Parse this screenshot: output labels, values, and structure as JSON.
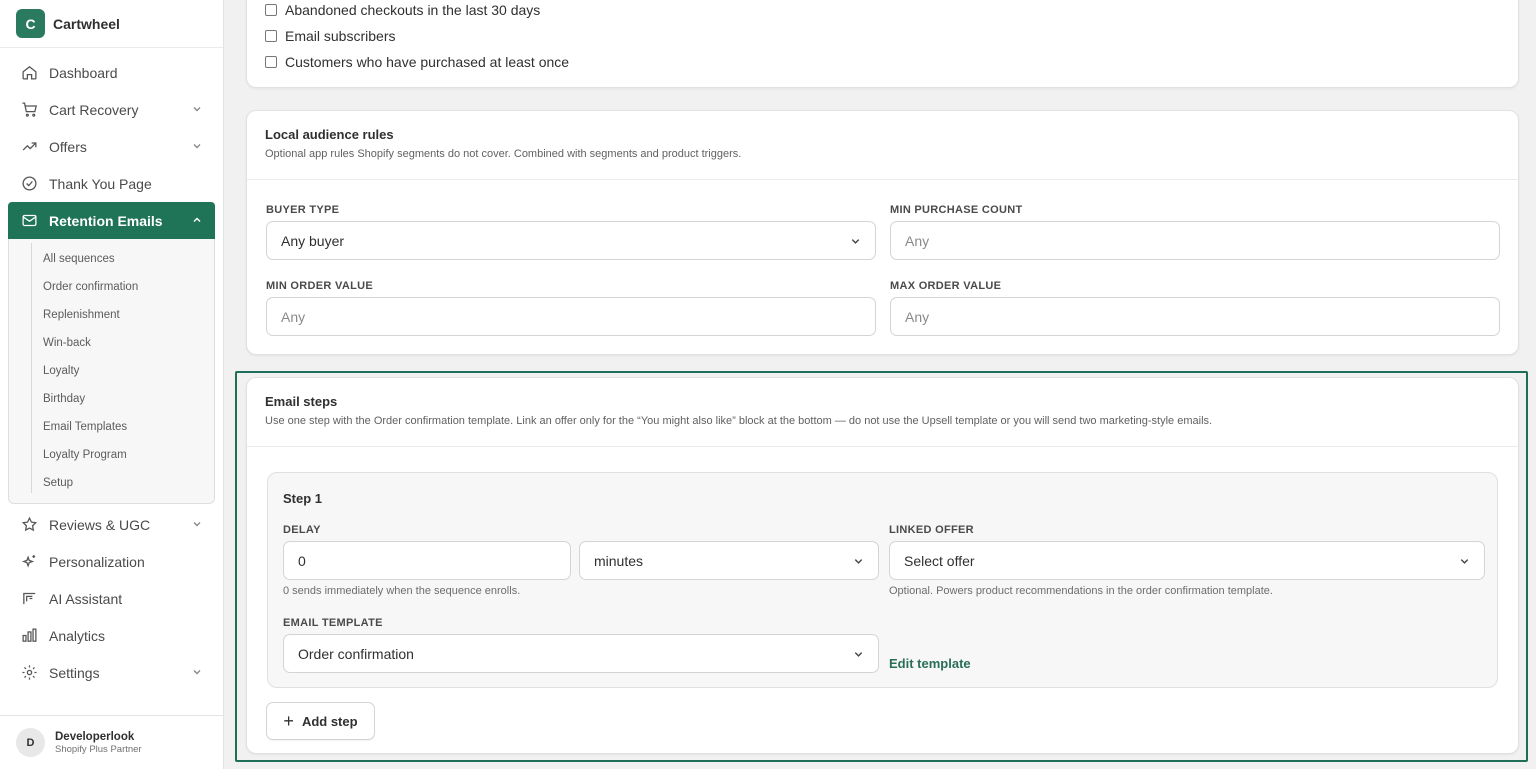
{
  "app": {
    "logo_letter": "C",
    "name": "Cartwheel"
  },
  "sidebar": {
    "items": [
      {
        "label": "Dashboard",
        "icon": "home-icon"
      },
      {
        "label": "Cart Recovery",
        "icon": "cart-icon",
        "has_chevron": true
      },
      {
        "label": "Offers",
        "icon": "trending-up-icon",
        "has_chevron": true
      },
      {
        "label": "Thank You Page",
        "icon": "check-circle-icon"
      },
      {
        "label": "Retention Emails",
        "icon": "mail-icon",
        "active": true
      },
      {
        "label": "Reviews & UGC",
        "icon": "star-icon",
        "has_chevron": true
      },
      {
        "label": "Personalization",
        "icon": "sparkle-icon"
      },
      {
        "label": "AI Assistant",
        "icon": "ai-icon"
      },
      {
        "label": "Analytics",
        "icon": "bar-chart-icon"
      },
      {
        "label": "Settings",
        "icon": "gear-icon",
        "has_chevron": true
      }
    ],
    "retention_subitems": [
      "All sequences",
      "Order confirmation",
      "Replenishment",
      "Win-back",
      "Loyalty",
      "Birthday",
      "Email Templates",
      "Loyalty Program",
      "Setup"
    ]
  },
  "user": {
    "initial": "D",
    "name": "Developerlook",
    "role": "Shopify Plus Partner"
  },
  "segments": {
    "options": [
      "Abandoned checkouts in the last 30 days",
      "Email subscribers",
      "Customers who have purchased at least once"
    ]
  },
  "local_rules": {
    "title": "Local audience rules",
    "description": "Optional app rules Shopify segments do not cover. Combined with segments and product triggers.",
    "buyer_type_label": "BUYER TYPE",
    "buyer_type_value": "Any buyer",
    "min_purchase_label": "MIN PURCHASE COUNT",
    "min_purchase_placeholder": "Any",
    "min_order_label": "MIN ORDER VALUE",
    "min_order_placeholder": "Any",
    "max_order_label": "MAX ORDER VALUE",
    "max_order_placeholder": "Any"
  },
  "email_steps": {
    "title": "Email steps",
    "description": "Use one step with the Order confirmation template. Link an offer only for the “You might also like” block at the bottom — do not use the Upsell template or you will send two marketing-style emails.",
    "step": {
      "title": "Step 1",
      "delay_label": "DELAY",
      "delay_value": "0",
      "delay_unit": "minutes",
      "delay_hint": "0 sends immediately when the sequence enrolls.",
      "linked_offer_label": "LINKED OFFER",
      "linked_offer_value": "Select offer",
      "linked_offer_hint": "Optional. Powers product recommendations in the order confirmation template.",
      "template_label": "EMAIL TEMPLATE",
      "template_value": "Order confirmation",
      "edit_template_link": "Edit template"
    },
    "add_step_label": "Add step"
  },
  "colors": {
    "accent": "#1f7356",
    "link": "#2a6e5a"
  }
}
